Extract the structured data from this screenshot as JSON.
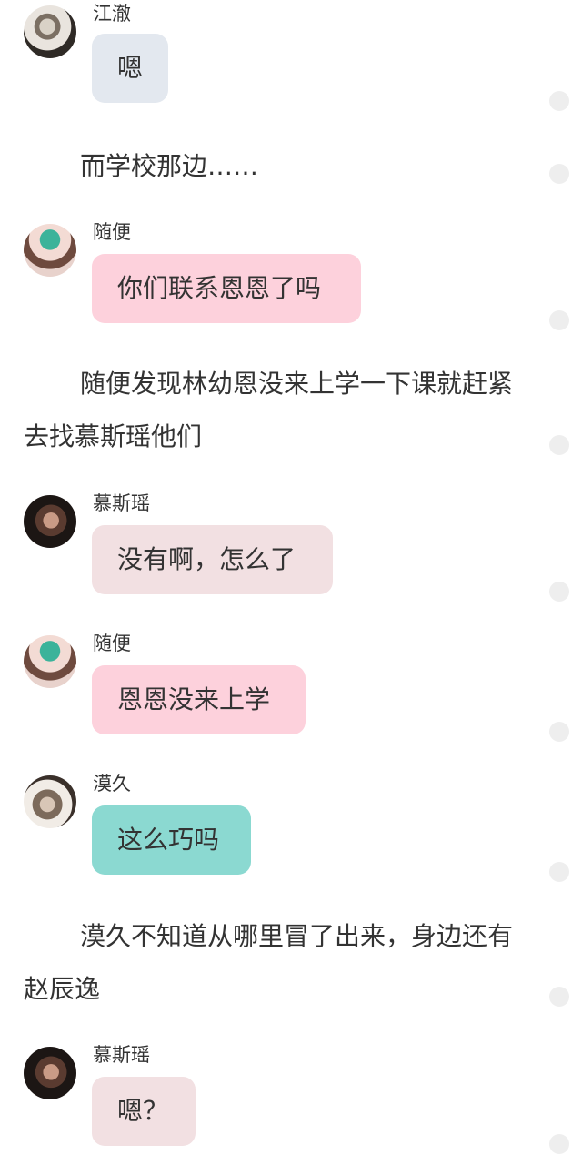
{
  "messages": [
    {
      "type": "chat",
      "name": "江澈",
      "text": "嗯",
      "avatar": "avatar-jiangche",
      "bubble_color": "#e3e8ef"
    },
    {
      "type": "narration",
      "text": "而学校那边……"
    },
    {
      "type": "chat",
      "name": "随便",
      "text": "你们联系恩恩了吗",
      "avatar": "avatar-suibian",
      "bubble_color": "#fdd1dc"
    },
    {
      "type": "narration",
      "text": "随便发现林幼恩没来上学一下课就赶紧去找慕斯瑶他们"
    },
    {
      "type": "chat",
      "name": "慕斯瑶",
      "text": "没有啊，怎么了",
      "avatar": "avatar-musiyao",
      "bubble_color": "#f2e0e2"
    },
    {
      "type": "chat",
      "name": "随便",
      "text": "恩恩没来上学",
      "avatar": "avatar-suibian",
      "bubble_color": "#fdd1dc"
    },
    {
      "type": "chat",
      "name": "漠久",
      "text": "这么巧吗",
      "avatar": "avatar-mojiu",
      "bubble_color": "#8bd9d1"
    },
    {
      "type": "narration",
      "text": "漠久不知道从哪里冒了出来，身边还有赵辰逸"
    },
    {
      "type": "chat",
      "name": "慕斯瑶",
      "text": "嗯？",
      "avatar": "avatar-musiyao",
      "bubble_color": "#f2e0e2"
    }
  ]
}
